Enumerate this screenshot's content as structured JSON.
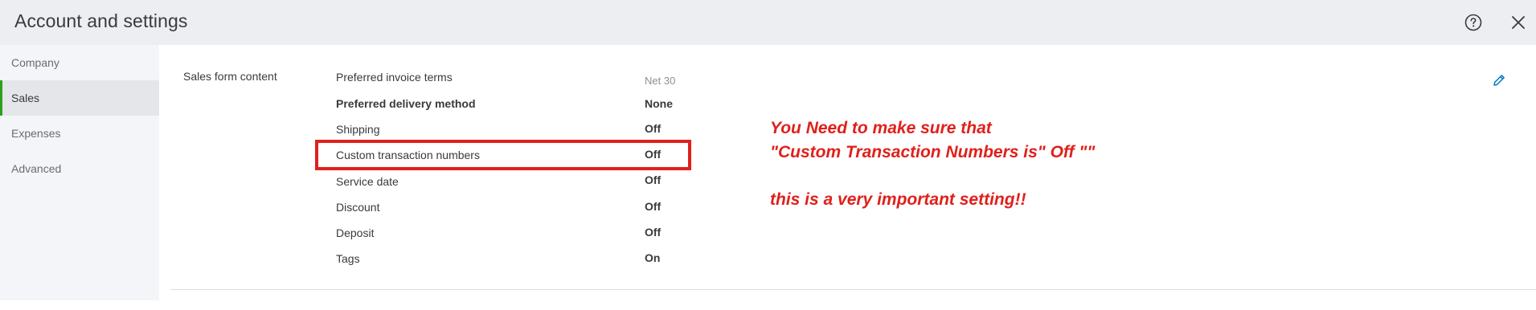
{
  "header": {
    "title": "Account and settings",
    "help_icon": "question-circle-icon",
    "close_icon": "close-icon"
  },
  "sidebar": {
    "items": [
      {
        "label": "Company",
        "active": false
      },
      {
        "label": "Sales",
        "active": true
      },
      {
        "label": "Expenses",
        "active": false
      },
      {
        "label": "Advanced",
        "active": false
      }
    ],
    "accent_color": "#2ca01c"
  },
  "section": {
    "label": "Sales form content",
    "edit_icon": "pencil-icon",
    "rows": [
      {
        "label": "Preferred invoice terms",
        "value": "Net 30"
      },
      {
        "label": "Preferred delivery method",
        "value": "None"
      },
      {
        "label": "Shipping",
        "value": "Off"
      },
      {
        "label": "Custom transaction numbers",
        "value": "Off"
      },
      {
        "label": "Service date",
        "value": "Off"
      },
      {
        "label": "Discount",
        "value": "Off"
      },
      {
        "label": "Deposit",
        "value": "Off"
      },
      {
        "label": "Tags",
        "value": "On"
      }
    ]
  },
  "annotation": {
    "line1": "You Need to make sure that",
    "line2": "\"Custom Transaction Numbers is\" Off \"\"",
    "line3": "this is a very important setting!!",
    "color": "#e0201b"
  }
}
